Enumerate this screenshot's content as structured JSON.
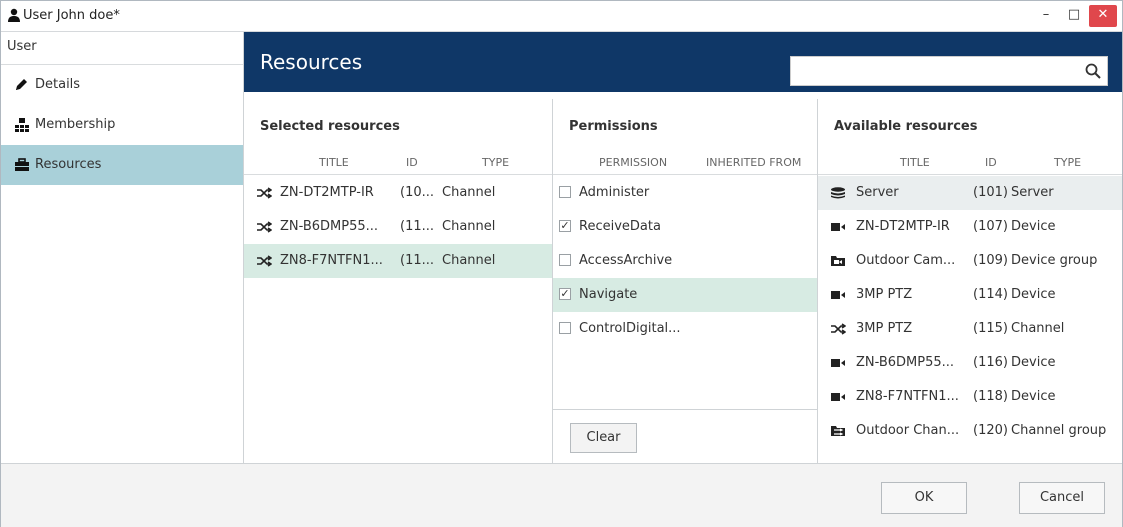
{
  "window": {
    "title": "User John doe*",
    "controls": {
      "minimize": "–",
      "maximize": "□",
      "close": "✕"
    }
  },
  "sidebar": {
    "header": "User",
    "items": [
      {
        "label": "Details",
        "icon": "pencil-icon",
        "active": false
      },
      {
        "label": "Membership",
        "icon": "group-icon",
        "active": false
      },
      {
        "label": "Resources",
        "icon": "briefcase-icon",
        "active": true
      }
    ]
  },
  "header": {
    "title": "Resources",
    "search": {
      "value": "",
      "placeholder": ""
    }
  },
  "selected": {
    "title": "Selected resources",
    "columns": [
      "TITLE",
      "ID",
      "TYPE"
    ],
    "rows": [
      {
        "title": "ZN-DT2MTP-IR",
        "id": "(10...",
        "type": "Channel",
        "icon": "channel-icon"
      },
      {
        "title": "ZN-B6DMP55...",
        "id": "(11...",
        "type": "Channel",
        "icon": "channel-icon"
      },
      {
        "title": "ZN8-F7NTFN1...",
        "id": "(11...",
        "type": "Channel",
        "icon": "channel-icon"
      }
    ]
  },
  "permissions": {
    "title": "Permissions",
    "columns": [
      "PERMISSION",
      "INHERITED FROM"
    ],
    "rows": [
      {
        "label": "Administer",
        "checked": false
      },
      {
        "label": "ReceiveData",
        "checked": true
      },
      {
        "label": "AccessArchive",
        "checked": false
      },
      {
        "label": "Navigate",
        "checked": true
      },
      {
        "label": "ControlDigital...",
        "checked": false
      }
    ],
    "clear_label": "Clear"
  },
  "available": {
    "title": "Available resources",
    "columns": [
      "TITLE",
      "ID",
      "TYPE"
    ],
    "rows": [
      {
        "title": "Server",
        "id": "(101)",
        "type": "Server",
        "icon": "server-icon"
      },
      {
        "title": "ZN-DT2MTP-IR",
        "id": "(107)",
        "type": "Device",
        "icon": "camera-icon"
      },
      {
        "title": "Outdoor Cam...",
        "id": "(109)",
        "type": "Device group",
        "icon": "folder-icon"
      },
      {
        "title": "3MP PTZ",
        "id": "(114)",
        "type": "Device",
        "icon": "camera-icon"
      },
      {
        "title": "3MP PTZ",
        "id": "(115)",
        "type": "Channel",
        "icon": "channel-icon"
      },
      {
        "title": "ZN-B6DMP55...",
        "id": "(116)",
        "type": "Device",
        "icon": "camera-icon"
      },
      {
        "title": "ZN8-F7NTFN1...",
        "id": "(118)",
        "type": "Device",
        "icon": "camera-icon"
      },
      {
        "title": "Outdoor Chan...",
        "id": "(120)",
        "type": "Channel group",
        "icon": "channel-folder-icon"
      }
    ]
  },
  "footer": {
    "ok_label": "OK",
    "cancel_label": "Cancel"
  },
  "colors": {
    "header_bg": "#0f3767",
    "sidebar_active": "#a9d0d9",
    "row_selected": "#d7ebe3",
    "close_button": "#e0474c"
  }
}
